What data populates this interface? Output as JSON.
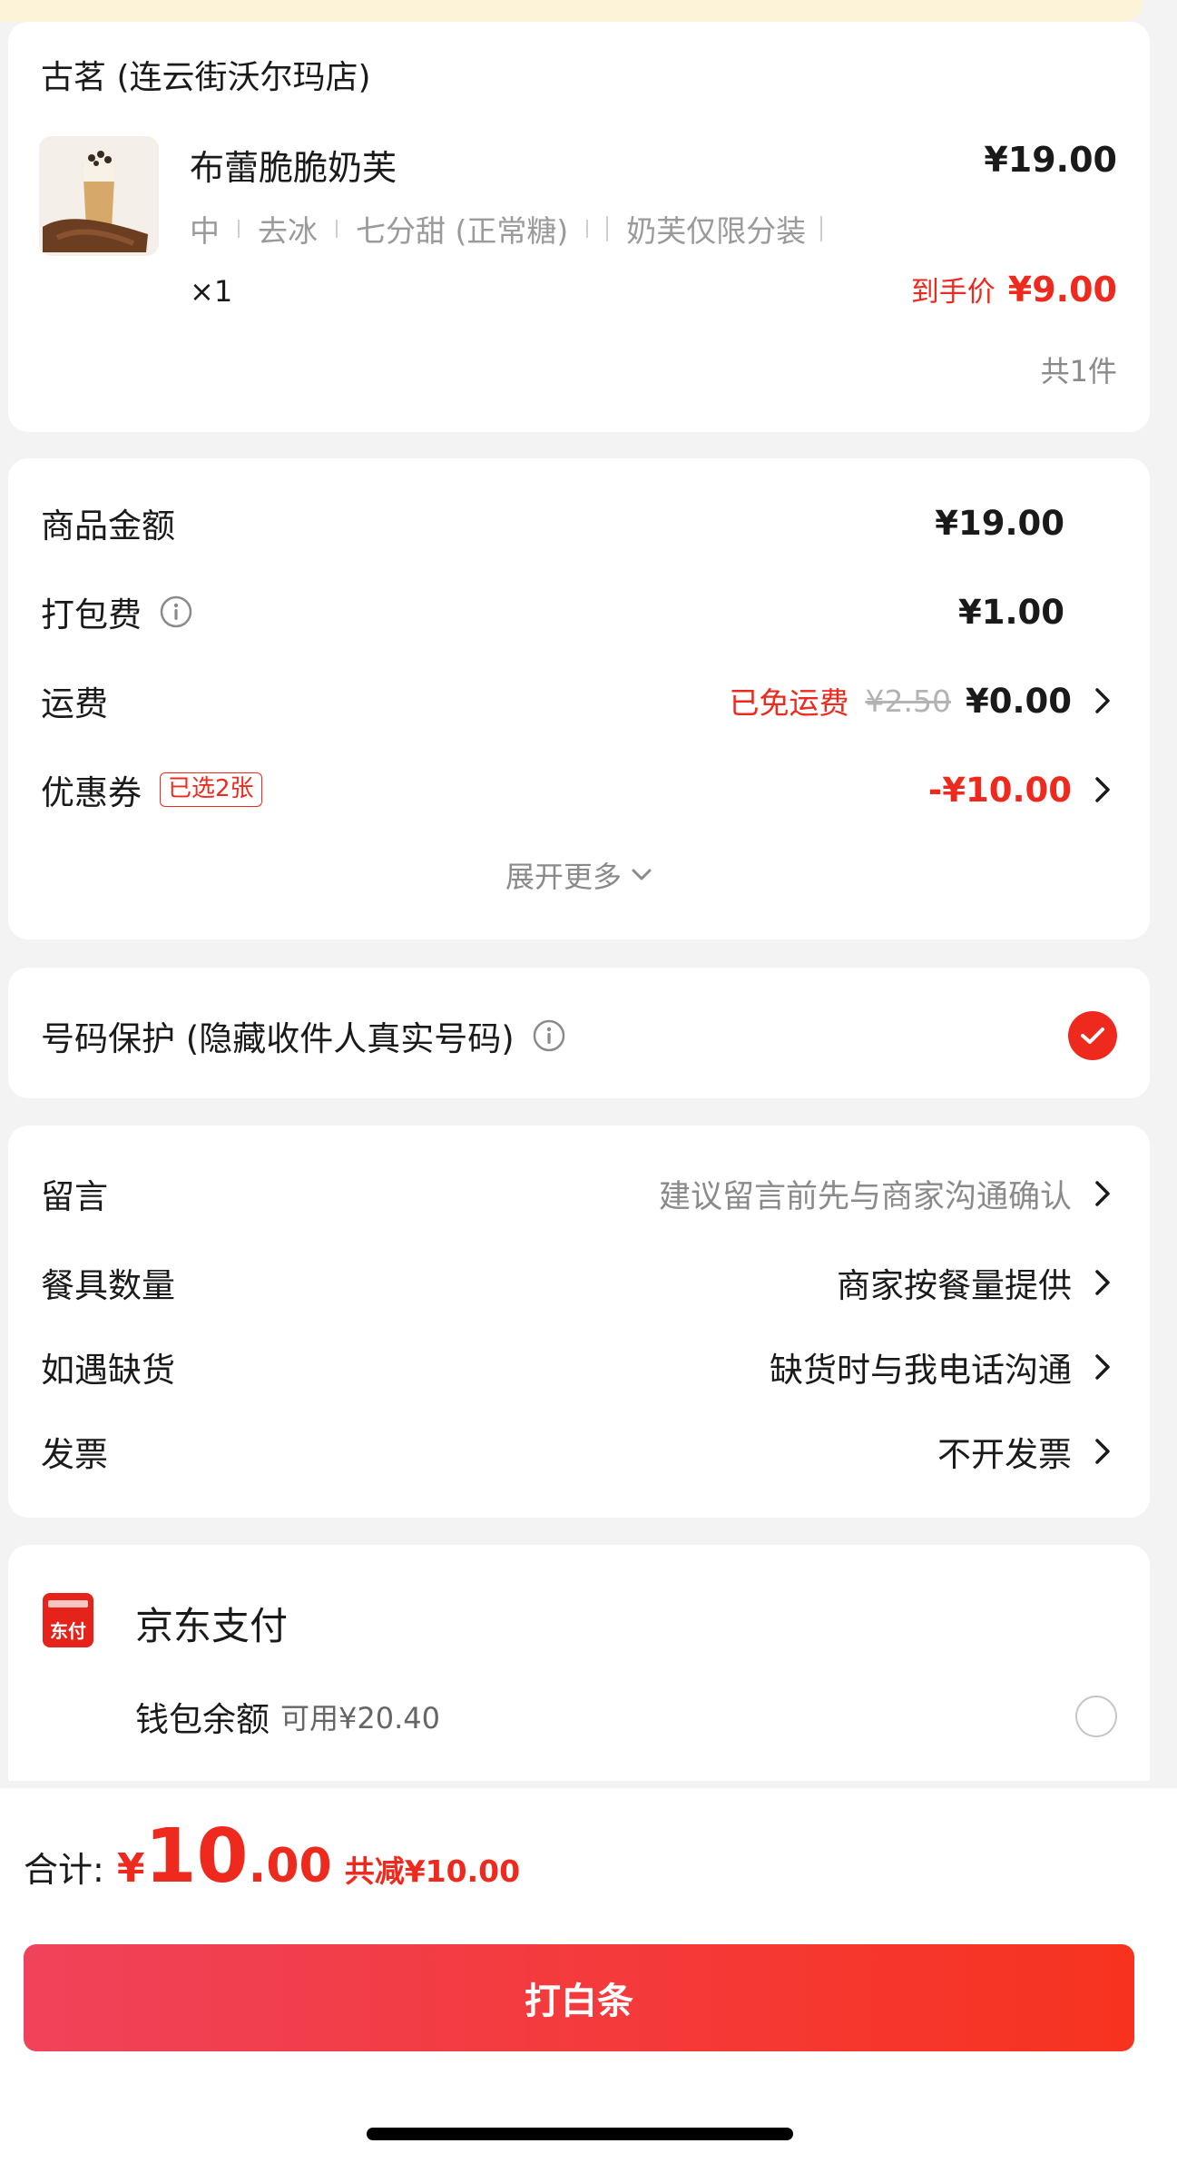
{
  "store": {
    "name": "古茗 (连云街沃尔玛店)"
  },
  "item": {
    "name": "布蕾脆脆奶芙",
    "price": "¥19.00",
    "specs": [
      "中",
      "去冰",
      "七分甜 (正常糖)",
      "",
      "奶芙仅限分装"
    ],
    "quantity": "×1",
    "final_price_label": "到手价",
    "final_price": "¥9.00",
    "total_count": "共1件"
  },
  "fees": {
    "goods_label": "商品金额",
    "goods_value": "¥19.00",
    "packing_label": "打包费",
    "packing_value": "¥1.00",
    "shipping_label": "运费",
    "shipping_free_text": "已免运费",
    "shipping_original": "¥2.50",
    "shipping_value": "¥0.00",
    "coupon_label": "优惠券",
    "coupon_badge": "已选2张",
    "coupon_value": "-¥10.00",
    "expand_label": "展开更多"
  },
  "privacy": {
    "label": "号码保护 (隐藏收件人真实号码)",
    "checked": true
  },
  "options": [
    {
      "label": "留言",
      "value": "建议留言前先与商家沟通确认",
      "muted": true
    },
    {
      "label": "餐具数量",
      "value": "商家按餐量提供",
      "muted": false
    },
    {
      "label": "如遇缺货",
      "value": "缺货时与我电话沟通",
      "muted": false
    },
    {
      "label": "发票",
      "value": "不开发票",
      "muted": false
    }
  ],
  "payment": {
    "logo_text": "东付",
    "method": "京东支付",
    "wallet_label": "钱包余额",
    "wallet_available": "可用¥20.40"
  },
  "footer": {
    "total_label": "合计:",
    "currency": "¥",
    "total_int": "10",
    "total_dec": ".00",
    "discount": "共减¥10.00",
    "pay_button": "打白条"
  },
  "colors": {
    "accent": "#ee2a1e",
    "button_start": "#f0425a",
    "button_end": "#f7331f"
  }
}
